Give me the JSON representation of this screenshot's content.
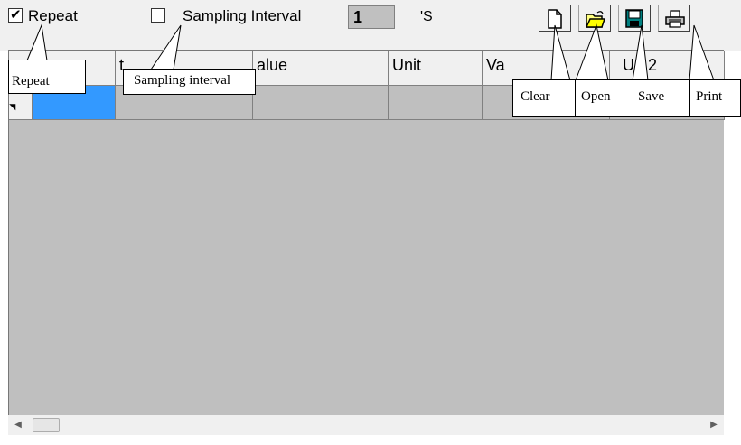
{
  "toolbar": {
    "repeat_label": "Repeat",
    "repeat_checked": true,
    "sampling_label": "Sampling Interval",
    "sampling_checked": false,
    "interval_value": "1",
    "interval_unit": "'S",
    "buttons": [
      {
        "name": "clear",
        "icon": "new-document-icon"
      },
      {
        "name": "open",
        "icon": "open-folder-icon"
      },
      {
        "name": "save",
        "icon": "floppy-disk-icon"
      },
      {
        "name": "print",
        "icon": "printer-icon"
      }
    ]
  },
  "grid": {
    "columns": [
      "",
      "",
      "Value",
      "Unit",
      "Value2",
      "Unit2"
    ],
    "visible_header_text": [
      "",
      "t",
      "alue",
      "Unit",
      "Va",
      "Un 2"
    ],
    "selected_cell_color": "#3399ff",
    "background_color": "#bfbfbf"
  },
  "callouts": {
    "repeat": "Repeat",
    "sampling": "Sampling interval",
    "clear": "Clear",
    "open": "Open",
    "save": "Save",
    "print": "Print"
  }
}
